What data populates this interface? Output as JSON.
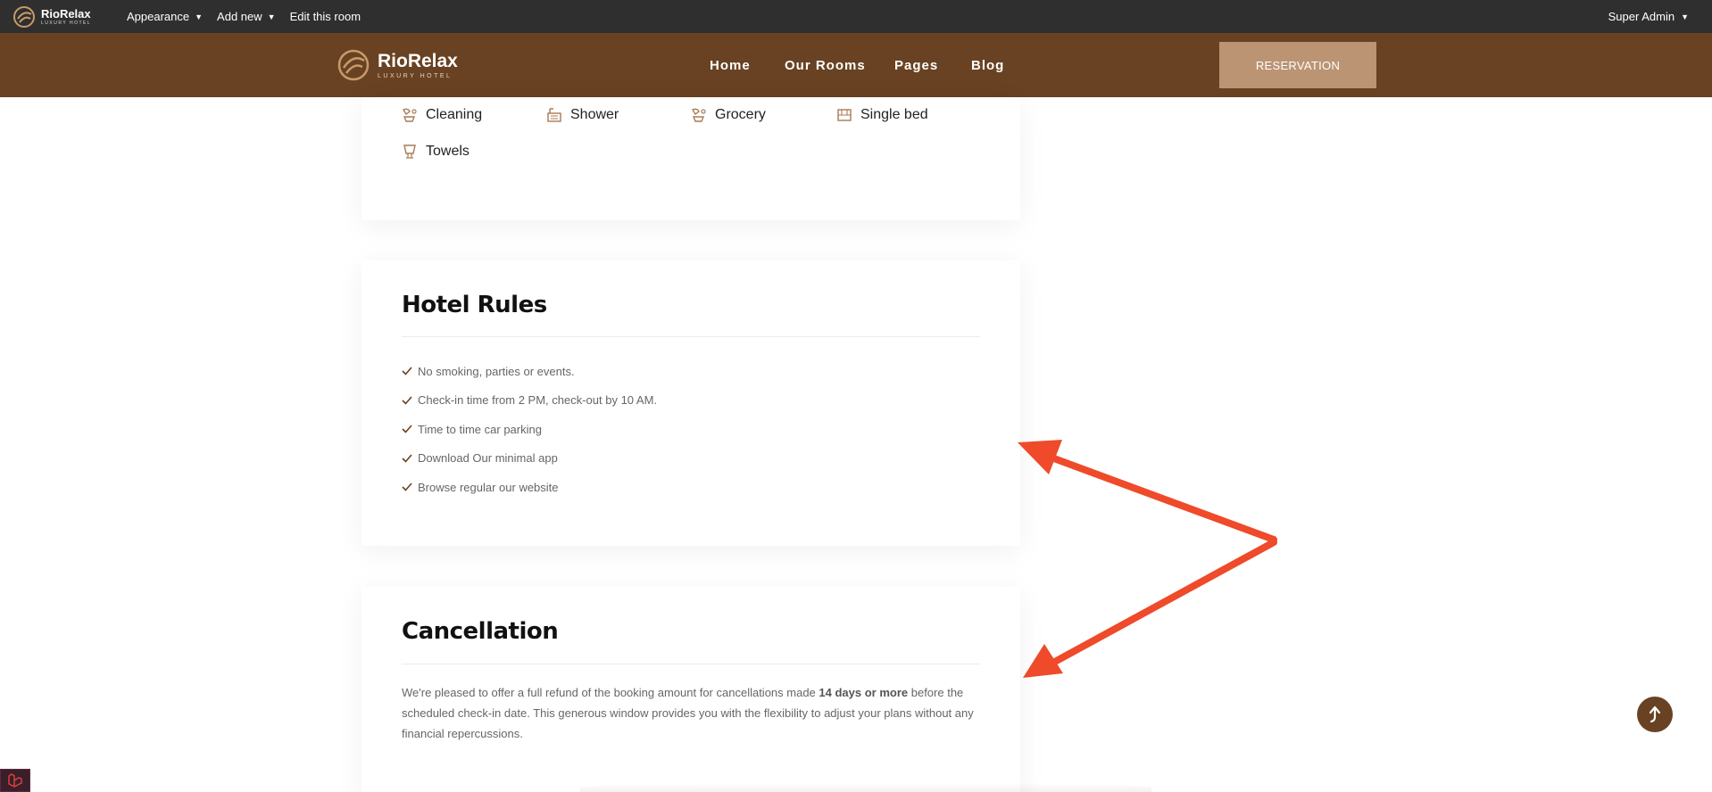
{
  "admin_bar": {
    "logo": {
      "name": "RioRelax",
      "sub": "LUXURY HOTEL"
    },
    "menu": [
      {
        "label": "Appearance",
        "has_dropdown": true
      },
      {
        "label": "Add new",
        "has_dropdown": true
      },
      {
        "label": "Edit this room",
        "has_dropdown": false
      }
    ],
    "user": {
      "label": "Super Admin"
    }
  },
  "header": {
    "logo": {
      "name": "RioRelax",
      "sub": "LUXURY HOTEL"
    },
    "nav": [
      "Home",
      "Our Rooms",
      "Pages",
      "Blog"
    ],
    "cta_label": "RESERVATION"
  },
  "amenities": [
    {
      "label": "Cleaning",
      "icon": "cleaning-icon"
    },
    {
      "label": "Shower",
      "icon": "shower-icon"
    },
    {
      "label": "Grocery",
      "icon": "grocery-icon"
    },
    {
      "label": "Single bed",
      "icon": "single-bed-icon"
    },
    {
      "label": "Towels",
      "icon": "towels-icon"
    }
  ],
  "hotel_rules": {
    "title": "Hotel Rules",
    "items": [
      "No smoking, parties or events.",
      "Check-in time from 2 PM, check-out by 10 AM.",
      "Time to time car parking",
      "Download Our minimal app",
      "Browse regular our website"
    ]
  },
  "cancellation": {
    "title": "Cancellation",
    "text_before": "We're pleased to offer a full refund of the booking amount for cancellations made ",
    "text_bold": "14 days or more",
    "text_after": " before the scheduled check-in date. This generous window provides you with the flexibility to adjust your plans without any financial repercussions."
  },
  "colors": {
    "admin_bar": "#2f2f2f",
    "header": "#684222",
    "cta": "#bb9473",
    "annotation_arrow": "#ef4a2a"
  }
}
